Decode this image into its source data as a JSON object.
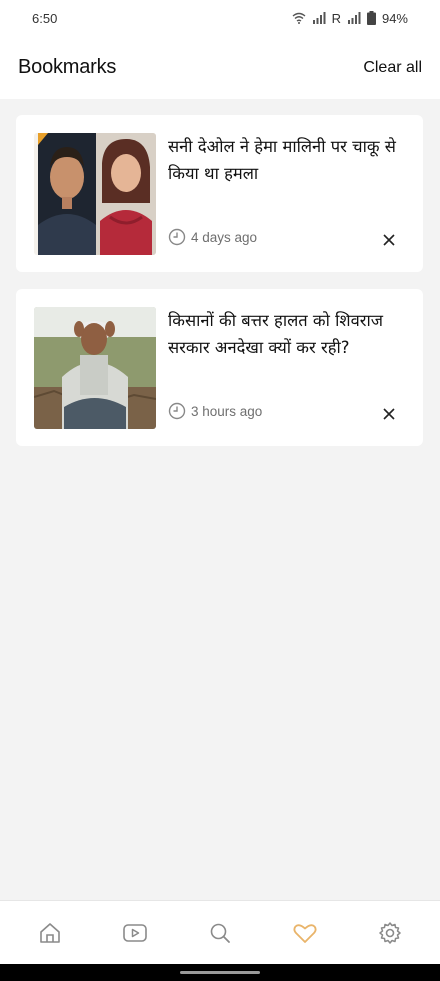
{
  "status_bar": {
    "time": "6:50",
    "carrier": "R",
    "battery": "94%"
  },
  "appbar": {
    "title": "Bookmarks",
    "clear_all": "Clear all"
  },
  "bookmarks": [
    {
      "title": "सनी देओल ने हेमा मालिनी पर चाकू से किया था हमला",
      "time": "4 days ago",
      "thumbnail": "two-portrait-photo"
    },
    {
      "title": "किसानों की बत्तर हालत को शिवराज सरकार अनदेखा क्यों कर रही?",
      "time": "3 hours ago",
      "thumbnail": "farmer-field-photo"
    }
  ],
  "bottom_nav": [
    {
      "icon": "home-icon",
      "active": false
    },
    {
      "icon": "video-icon",
      "active": false
    },
    {
      "icon": "search-icon",
      "active": false
    },
    {
      "icon": "heart-icon",
      "active": true
    },
    {
      "icon": "gear-icon",
      "active": false
    }
  ],
  "colors": {
    "accent": "#e9b46a",
    "icon": "#8a8a8a",
    "background": "#f3f3f3"
  }
}
